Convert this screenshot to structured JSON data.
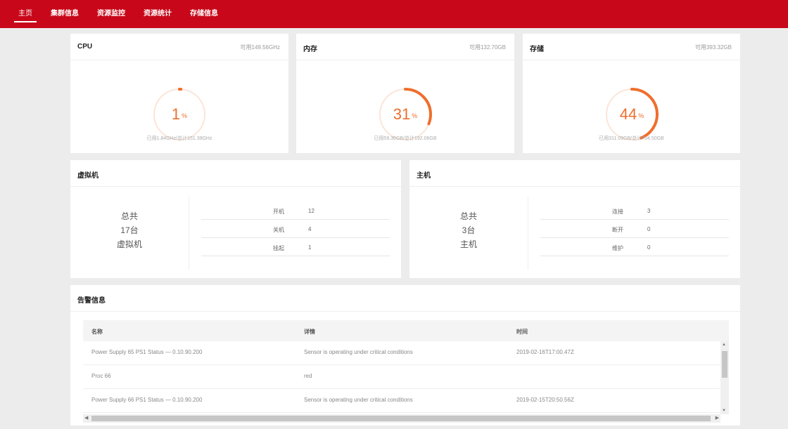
{
  "nav": {
    "items": [
      "主页",
      "集群信息",
      "资源监控",
      "资源统计",
      "存储信息"
    ]
  },
  "colors": {
    "brand": "#c8081a",
    "accent": "#ee6e2c",
    "ring_track": "#fbe5d9"
  },
  "resources": [
    {
      "title": "CPU",
      "available": "可用149.56GHz",
      "percent": 1,
      "pct_sign": "%",
      "usage": "已用1.84GHz/总计151.39GHz"
    },
    {
      "title": "内存",
      "available": "可用132.70GB",
      "percent": 31,
      "pct_sign": "%",
      "usage": "已用59.36GB/总计192.06GB"
    },
    {
      "title": "存储",
      "available": "可用393.32GB",
      "percent": 44,
      "pct_sign": "%",
      "usage": "已用311.09GB/总计704.50GB"
    }
  ],
  "vm": {
    "title": "虚拟机",
    "summary": [
      "总共",
      "17台",
      "虚拟机"
    ],
    "stats": [
      {
        "label": "开机",
        "value": "12"
      },
      {
        "label": "关机",
        "value": "4"
      },
      {
        "label": "挂起",
        "value": "1"
      }
    ]
  },
  "host": {
    "title": "主机",
    "summary": [
      "总共",
      "3台",
      "主机"
    ],
    "stats": [
      {
        "label": "连接",
        "value": "3"
      },
      {
        "label": "断开",
        "value": "0"
      },
      {
        "label": "维护",
        "value": "0"
      }
    ]
  },
  "alarms": {
    "title": "告警信息",
    "columns": [
      "名称",
      "详情",
      "时间"
    ],
    "rows": [
      {
        "name": "Power Supply 65 PS1 Status — 0.10.90.200",
        "detail": "Sensor is operating under critical conditions",
        "time": "2019-02-16T17:00.47Z"
      },
      {
        "name": "Proc 66",
        "detail": "red",
        "time": ""
      },
      {
        "name": "Power Supply 66 PS1 Status — 0.10.90.200",
        "detail": "Sensor is operating under critical conditions",
        "time": "2019-02-15T20:50.56Z"
      }
    ]
  }
}
